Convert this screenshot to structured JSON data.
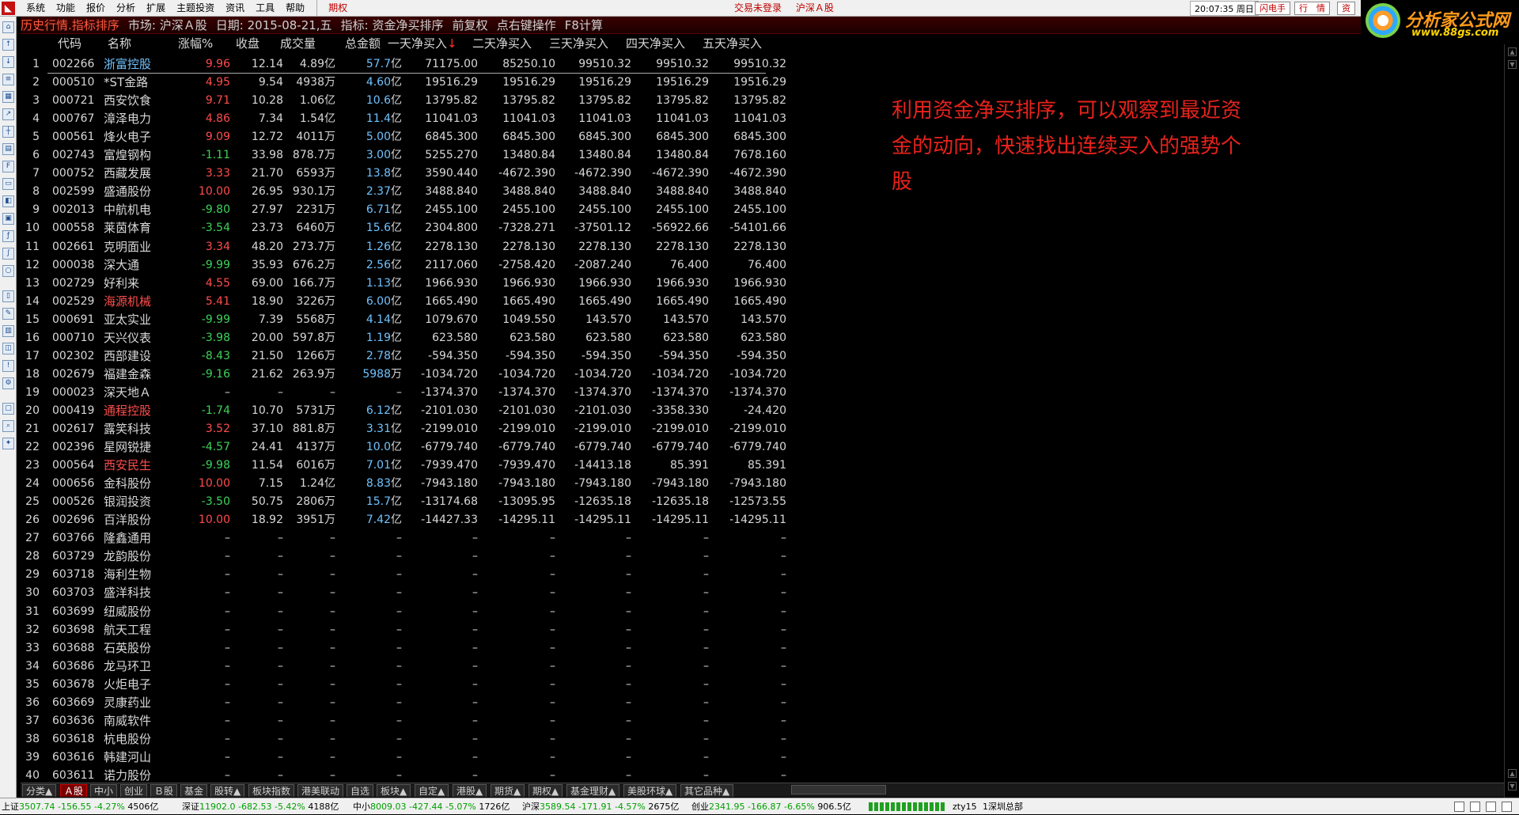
{
  "menu": {
    "items": [
      "系统",
      "功能",
      "报价",
      "分析",
      "扩展",
      "主题投资",
      "资讯",
      "工具",
      "帮助"
    ],
    "qq_label": "期权",
    "login_status": "交易未登录",
    "market": "沪深Ａ股",
    "clock": "20:07:35 周日",
    "btn_flash": "闪电手",
    "btn_quote": "行　情",
    "btn_zi": "资"
  },
  "logo": {
    "title": "分析家公式网",
    "url": "www.88gs.com"
  },
  "title": {
    "history": "历史行情.指标排序",
    "market": "市场: 沪深Ａ股",
    "date": "日期: 2015-08-21,五",
    "indicator": "指标: 资金净买排序",
    "fq": "前复权",
    "rclick": "点右键操作",
    "f8": "F8计算"
  },
  "columns": [
    "代码",
    "名称",
    "涨幅%",
    "收盘",
    "成交量",
    "总金额",
    "一天净买入",
    "二天净买入",
    "三天净买入",
    "四天净买入",
    "五天净买入"
  ],
  "sort_arrow": "↓",
  "rows": [
    {
      "idx": "1",
      "code": "002266",
      "name": "浙富控股",
      "nc": "hl",
      "pct": "9.96",
      "pc": "up",
      "close": "12.14",
      "vol": "4.89",
      "vu": "亿",
      "amt": "57.7",
      "au": "亿",
      "d1": "71175.00",
      "d2": "85250.10",
      "d3": "99510.32",
      "d4": "99510.32",
      "d5": "99510.32"
    },
    {
      "idx": "2",
      "code": "000510",
      "name": "*ST金路",
      "nc": "",
      "pct": "4.95",
      "pc": "up",
      "close": "9.54",
      "vol": "4938",
      "vu": "万",
      "amt": "4.60",
      "au": "亿",
      "d1": "19516.29",
      "d2": "19516.29",
      "d3": "19516.29",
      "d4": "19516.29",
      "d5": "19516.29"
    },
    {
      "idx": "3",
      "code": "000721",
      "name": "西安饮食",
      "nc": "",
      "pct": "9.71",
      "pc": "up",
      "close": "10.28",
      "vol": "1.06",
      "vu": "亿",
      "amt": "10.6",
      "au": "亿",
      "d1": "13795.82",
      "d2": "13795.82",
      "d3": "13795.82",
      "d4": "13795.82",
      "d5": "13795.82"
    },
    {
      "idx": "4",
      "code": "000767",
      "name": "漳泽电力",
      "nc": "",
      "pct": "4.86",
      "pc": "up",
      "close": "7.34",
      "vol": "1.54",
      "vu": "亿",
      "amt": "11.4",
      "au": "亿",
      "d1": "11041.03",
      "d2": "11041.03",
      "d3": "11041.03",
      "d4": "11041.03",
      "d5": "11041.03"
    },
    {
      "idx": "5",
      "code": "000561",
      "name": "烽火电子",
      "nc": "",
      "pct": "9.09",
      "pc": "up",
      "close": "12.72",
      "vol": "4011",
      "vu": "万",
      "amt": "5.00",
      "au": "亿",
      "d1": "6845.300",
      "d2": "6845.300",
      "d3": "6845.300",
      "d4": "6845.300",
      "d5": "6845.300"
    },
    {
      "idx": "6",
      "code": "002743",
      "name": "富煌钢构",
      "nc": "",
      "pct": "-1.11",
      "pc": "down",
      "close": "33.98",
      "vol": "878.7",
      "vu": "万",
      "amt": "3.00",
      "au": "亿",
      "d1": "5255.270",
      "d2": "13480.84",
      "d3": "13480.84",
      "d4": "13480.84",
      "d5": "7678.160"
    },
    {
      "idx": "7",
      "code": "000752",
      "name": "西藏发展",
      "nc": "",
      "pct": "3.33",
      "pc": "up",
      "close": "21.70",
      "vol": "6593",
      "vu": "万",
      "amt": "13.8",
      "au": "亿",
      "d1": "3590.440",
      "d2": "-4672.390",
      "d3": "-4672.390",
      "d4": "-4672.390",
      "d5": "-4672.390"
    },
    {
      "idx": "8",
      "code": "002599",
      "name": "盛通股份",
      "nc": "",
      "pct": "10.00",
      "pc": "up",
      "close": "26.95",
      "vol": "930.1",
      "vu": "万",
      "amt": "2.37",
      "au": "亿",
      "d1": "3488.840",
      "d2": "3488.840",
      "d3": "3488.840",
      "d4": "3488.840",
      "d5": "3488.840"
    },
    {
      "idx": "9",
      "code": "002013",
      "name": "中航机电",
      "nc": "",
      "pct": "-9.80",
      "pc": "down",
      "close": "27.97",
      "vol": "2231",
      "vu": "万",
      "amt": "6.71",
      "au": "亿",
      "d1": "2455.100",
      "d2": "2455.100",
      "d3": "2455.100",
      "d4": "2455.100",
      "d5": "2455.100"
    },
    {
      "idx": "10",
      "code": "000558",
      "name": "莱茵体育",
      "nc": "",
      "pct": "-3.54",
      "pc": "down",
      "close": "23.73",
      "vol": "6460",
      "vu": "万",
      "amt": "15.6",
      "au": "亿",
      "d1": "2304.800",
      "d2": "-7328.271",
      "d3": "-37501.12",
      "d4": "-56922.66",
      "d5": "-54101.66"
    },
    {
      "idx": "11",
      "code": "002661",
      "name": "克明面业",
      "nc": "",
      "pct": "3.34",
      "pc": "up",
      "close": "48.20",
      "vol": "273.7",
      "vu": "万",
      "amt": "1.26",
      "au": "亿",
      "d1": "2278.130",
      "d2": "2278.130",
      "d3": "2278.130",
      "d4": "2278.130",
      "d5": "2278.130"
    },
    {
      "idx": "12",
      "code": "000038",
      "name": "深大通",
      "nc": "",
      "pct": "-9.99",
      "pc": "down",
      "close": "35.93",
      "vol": "676.2",
      "vu": "万",
      "amt": "2.56",
      "au": "亿",
      "d1": "2117.060",
      "d2": "-2758.420",
      "d3": "-2087.240",
      "d4": "76.400",
      "d5": "76.400"
    },
    {
      "idx": "13",
      "code": "002729",
      "name": "好利来",
      "nc": "",
      "pct": "4.55",
      "pc": "up",
      "close": "69.00",
      "vol": "166.7",
      "vu": "万",
      "amt": "1.13",
      "au": "亿",
      "d1": "1966.930",
      "d2": "1966.930",
      "d3": "1966.930",
      "d4": "1966.930",
      "d5": "1966.930"
    },
    {
      "idx": "14",
      "code": "002529",
      "name": "海源机械",
      "nc": "red",
      "pct": "5.41",
      "pc": "up",
      "close": "18.90",
      "vol": "3226",
      "vu": "万",
      "amt": "6.00",
      "au": "亿",
      "d1": "1665.490",
      "d2": "1665.490",
      "d3": "1665.490",
      "d4": "1665.490",
      "d5": "1665.490"
    },
    {
      "idx": "15",
      "code": "000691",
      "name": "亚太实业",
      "nc": "",
      "pct": "-9.99",
      "pc": "down",
      "close": "7.39",
      "vol": "5568",
      "vu": "万",
      "amt": "4.14",
      "au": "亿",
      "d1": "1079.670",
      "d2": "1049.550",
      "d3": "143.570",
      "d4": "143.570",
      "d5": "143.570"
    },
    {
      "idx": "16",
      "code": "000710",
      "name": "天兴仪表",
      "nc": "",
      "pct": "-3.98",
      "pc": "down",
      "close": "20.00",
      "vol": "597.8",
      "vu": "万",
      "amt": "1.19",
      "au": "亿",
      "d1": "623.580",
      "d2": "623.580",
      "d3": "623.580",
      "d4": "623.580",
      "d5": "623.580"
    },
    {
      "idx": "17",
      "code": "002302",
      "name": "西部建设",
      "nc": "",
      "pct": "-8.43",
      "pc": "down",
      "close": "21.50",
      "vol": "1266",
      "vu": "万",
      "amt": "2.78",
      "au": "亿",
      "d1": "-594.350",
      "d2": "-594.350",
      "d3": "-594.350",
      "d4": "-594.350",
      "d5": "-594.350"
    },
    {
      "idx": "18",
      "code": "002679",
      "name": "福建金森",
      "nc": "",
      "pct": "-9.16",
      "pc": "down",
      "close": "21.62",
      "vol": "263.9",
      "vu": "万",
      "amt": "5988",
      "au": "万",
      "d1": "-1034.720",
      "d2": "-1034.720",
      "d3": "-1034.720",
      "d4": "-1034.720",
      "d5": "-1034.720"
    },
    {
      "idx": "19",
      "code": "000023",
      "name": "深天地Ａ",
      "nc": "",
      "pct": "–",
      "pc": "flat",
      "close": "–",
      "vol": "–",
      "vu": "",
      "amt": "–",
      "au": "",
      "d1": "-1374.370",
      "d2": "-1374.370",
      "d3": "-1374.370",
      "d4": "-1374.370",
      "d5": "-1374.370"
    },
    {
      "idx": "20",
      "code": "000419",
      "name": "通程控股",
      "nc": "red",
      "pct": "-1.74",
      "pc": "down",
      "close": "10.70",
      "vol": "5731",
      "vu": "万",
      "amt": "6.12",
      "au": "亿",
      "d1": "-2101.030",
      "d2": "-2101.030",
      "d3": "-2101.030",
      "d4": "-3358.330",
      "d5": "-24.420"
    },
    {
      "idx": "21",
      "code": "002617",
      "name": "露笑科技",
      "nc": "",
      "pct": "3.52",
      "pc": "up",
      "close": "37.10",
      "vol": "881.8",
      "vu": "万",
      "amt": "3.31",
      "au": "亿",
      "d1": "-2199.010",
      "d2": "-2199.010",
      "d3": "-2199.010",
      "d4": "-2199.010",
      "d5": "-2199.010"
    },
    {
      "idx": "22",
      "code": "002396",
      "name": "星网锐捷",
      "nc": "",
      "pct": "-4.57",
      "pc": "down",
      "close": "24.41",
      "vol": "4137",
      "vu": "万",
      "amt": "10.0",
      "au": "亿",
      "d1": "-6779.740",
      "d2": "-6779.740",
      "d3": "-6779.740",
      "d4": "-6779.740",
      "d5": "-6779.740"
    },
    {
      "idx": "23",
      "code": "000564",
      "name": "西安民生",
      "nc": "red",
      "pct": "-9.98",
      "pc": "down",
      "close": "11.54",
      "vol": "6016",
      "vu": "万",
      "amt": "7.01",
      "au": "亿",
      "d1": "-7939.470",
      "d2": "-7939.470",
      "d3": "-14413.18",
      "d4": "85.391",
      "d5": "85.391"
    },
    {
      "idx": "24",
      "code": "000656",
      "name": "金科股份",
      "nc": "",
      "pct": "10.00",
      "pc": "up",
      "close": "7.15",
      "vol": "1.24",
      "vu": "亿",
      "amt": "8.83",
      "au": "亿",
      "d1": "-7943.180",
      "d2": "-7943.180",
      "d3": "-7943.180",
      "d4": "-7943.180",
      "d5": "-7943.180"
    },
    {
      "idx": "25",
      "code": "000526",
      "name": "银润投资",
      "nc": "",
      "pct": "-3.50",
      "pc": "down",
      "close": "50.75",
      "vol": "2806",
      "vu": "万",
      "amt": "15.7",
      "au": "亿",
      "d1": "-13174.68",
      "d2": "-13095.95",
      "d3": "-12635.18",
      "d4": "-12635.18",
      "d5": "-12573.55"
    },
    {
      "idx": "26",
      "code": "002696",
      "name": "百洋股份",
      "nc": "",
      "pct": "10.00",
      "pc": "up",
      "close": "18.92",
      "vol": "3951",
      "vu": "万",
      "amt": "7.42",
      "au": "亿",
      "d1": "-14427.33",
      "d2": "-14295.11",
      "d3": "-14295.11",
      "d4": "-14295.11",
      "d5": "-14295.11"
    },
    {
      "idx": "27",
      "code": "603766",
      "name": "隆鑫通用",
      "nc": "",
      "pct": "–",
      "pc": "flat",
      "close": "–",
      "vol": "–",
      "vu": "",
      "amt": "–",
      "au": "",
      "d1": "–",
      "d2": "–",
      "d3": "–",
      "d4": "–",
      "d5": "–"
    },
    {
      "idx": "28",
      "code": "603729",
      "name": "龙韵股份",
      "nc": "",
      "pct": "–",
      "pc": "flat",
      "close": "–",
      "vol": "–",
      "vu": "",
      "amt": "–",
      "au": "",
      "d1": "–",
      "d2": "–",
      "d3": "–",
      "d4": "–",
      "d5": "–"
    },
    {
      "idx": "29",
      "code": "603718",
      "name": "海利生物",
      "nc": "",
      "pct": "–",
      "pc": "flat",
      "close": "–",
      "vol": "–",
      "vu": "",
      "amt": "–",
      "au": "",
      "d1": "–",
      "d2": "–",
      "d3": "–",
      "d4": "–",
      "d5": "–"
    },
    {
      "idx": "30",
      "code": "603703",
      "name": "盛洋科技",
      "nc": "",
      "pct": "–",
      "pc": "flat",
      "close": "–",
      "vol": "–",
      "vu": "",
      "amt": "–",
      "au": "",
      "d1": "–",
      "d2": "–",
      "d3": "–",
      "d4": "–",
      "d5": "–"
    },
    {
      "idx": "31",
      "code": "603699",
      "name": "纽威股份",
      "nc": "",
      "pct": "–",
      "pc": "flat",
      "close": "–",
      "vol": "–",
      "vu": "",
      "amt": "–",
      "au": "",
      "d1": "–",
      "d2": "–",
      "d3": "–",
      "d4": "–",
      "d5": "–"
    },
    {
      "idx": "32",
      "code": "603698",
      "name": "航天工程",
      "nc": "",
      "pct": "–",
      "pc": "flat",
      "close": "–",
      "vol": "–",
      "vu": "",
      "amt": "–",
      "au": "",
      "d1": "–",
      "d2": "–",
      "d3": "–",
      "d4": "–",
      "d5": "–"
    },
    {
      "idx": "33",
      "code": "603688",
      "name": "石英股份",
      "nc": "",
      "pct": "–",
      "pc": "flat",
      "close": "–",
      "vol": "–",
      "vu": "",
      "amt": "–",
      "au": "",
      "d1": "–",
      "d2": "–",
      "d3": "–",
      "d4": "–",
      "d5": "–"
    },
    {
      "idx": "34",
      "code": "603686",
      "name": "龙马环卫",
      "nc": "",
      "pct": "–",
      "pc": "flat",
      "close": "–",
      "vol": "–",
      "vu": "",
      "amt": "–",
      "au": "",
      "d1": "–",
      "d2": "–",
      "d3": "–",
      "d4": "–",
      "d5": "–"
    },
    {
      "idx": "35",
      "code": "603678",
      "name": "火炬电子",
      "nc": "",
      "pct": "–",
      "pc": "flat",
      "close": "–",
      "vol": "–",
      "vu": "",
      "amt": "–",
      "au": "",
      "d1": "–",
      "d2": "–",
      "d3": "–",
      "d4": "–",
      "d5": "–"
    },
    {
      "idx": "36",
      "code": "603669",
      "name": "灵康药业",
      "nc": "",
      "pct": "–",
      "pc": "flat",
      "close": "–",
      "vol": "–",
      "vu": "",
      "amt": "–",
      "au": "",
      "d1": "–",
      "d2": "–",
      "d3": "–",
      "d4": "–",
      "d5": "–"
    },
    {
      "idx": "37",
      "code": "603636",
      "name": "南威软件",
      "nc": "",
      "pct": "–",
      "pc": "flat",
      "close": "–",
      "vol": "–",
      "vu": "",
      "amt": "–",
      "au": "",
      "d1": "–",
      "d2": "–",
      "d3": "–",
      "d4": "–",
      "d5": "–"
    },
    {
      "idx": "38",
      "code": "603618",
      "name": "杭电股份",
      "nc": "",
      "pct": "–",
      "pc": "flat",
      "close": "–",
      "vol": "–",
      "vu": "",
      "amt": "–",
      "au": "",
      "d1": "–",
      "d2": "–",
      "d3": "–",
      "d4": "–",
      "d5": "–"
    },
    {
      "idx": "39",
      "code": "603616",
      "name": "韩建河山",
      "nc": "",
      "pct": "–",
      "pc": "flat",
      "close": "–",
      "vol": "–",
      "vu": "",
      "amt": "–",
      "au": "",
      "d1": "–",
      "d2": "–",
      "d3": "–",
      "d4": "–",
      "d5": "–"
    },
    {
      "idx": "40",
      "code": "603611",
      "name": "诺力股份",
      "nc": "",
      "pct": "–",
      "pc": "flat",
      "close": "–",
      "vol": "–",
      "vu": "",
      "amt": "–",
      "au": "",
      "d1": "–",
      "d2": "–",
      "d3": "–",
      "d4": "–",
      "d5": "–"
    }
  ],
  "note": "利用资金净买排序，可以观察到最近资金的动向，快速找出连续买入的强势个股",
  "tabs": [
    "分类▲",
    "Ａ股",
    "中小",
    "创业",
    "Ｂ股",
    "基金",
    "股转▲",
    "板块指数",
    "港美联动",
    "自选",
    "板块▲",
    "自定▲",
    "港股▲",
    "期货▲",
    "期权▲",
    "基金理财▲",
    "美股环球▲",
    "其它品种▲"
  ],
  "active_tab": "Ａ股",
  "status": {
    "sh_label": "上证",
    "sh_val": "3507.74",
    "sh_chg": "-156.55",
    "sh_pct": "-4.27%",
    "sh_amt": "4506亿",
    "sz_label": "深证",
    "sz_val": "11902.0",
    "sz_chg": "-682.53",
    "sz_pct": "-5.42%",
    "sz_amt": "4188亿",
    "zx_label": "中小",
    "zx_val": "8009.03",
    "zx_chg": "-427.44",
    "zx_pct": "-5.07%",
    "zx_amt": "1726亿",
    "hs_label": "沪深",
    "hs_val": "3589.54",
    "hs_chg": "-171.91",
    "hs_pct": "-4.57%",
    "hs_amt": "2675亿",
    "cy_label": "创业",
    "cy_val": "2341.95",
    "cy_chg": "-166.87",
    "cy_pct": "-6.65%",
    "cy_amt": "906.5亿",
    "user": "zty15",
    "site": "1深圳总部"
  }
}
